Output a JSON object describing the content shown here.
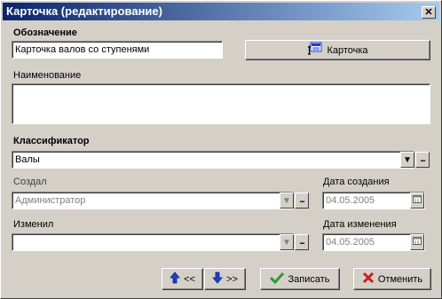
{
  "window": {
    "title": "Карточка (редактирование)"
  },
  "designation": {
    "label": "Обозначение",
    "value": "Карточка валов со ступенями",
    "card_button_label": "Карточка"
  },
  "name": {
    "label": "Наименование",
    "value": ""
  },
  "classifier": {
    "label": "Классификатор",
    "value": "Валы"
  },
  "created": {
    "by_label": "Создал",
    "by_value": "Администратор",
    "date_label": "Дата создания",
    "date_value": "04.05.2005"
  },
  "modified": {
    "by_label": "Изменил",
    "by_value": "",
    "date_label": "Дата изменения",
    "date_value": "04.05.2005"
  },
  "footer": {
    "prev_label": "<<",
    "next_label": ">>",
    "save_label": "Записать",
    "cancel_label": "Отменить"
  },
  "colors": {
    "title_start": "#0a246a",
    "title_end": "#a6caf0",
    "face": "#d4d0c8",
    "arrow_blue": "#1e3fd0",
    "check_green": "#2e9a2e",
    "cross_red": "#c8201c"
  }
}
